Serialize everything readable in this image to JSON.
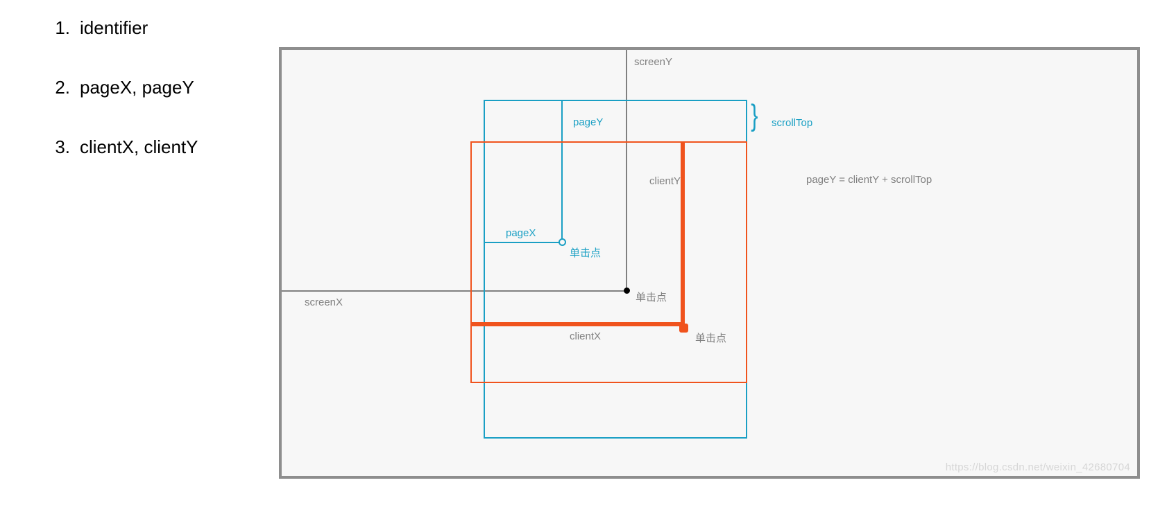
{
  "list": {
    "items": [
      {
        "num": "1.",
        "label": "identifier"
      },
      {
        "num": "2.",
        "label": "pageX, pageY"
      },
      {
        "num": "3.",
        "label": "clientX, clientY"
      }
    ]
  },
  "diagram": {
    "screenY": "screenY",
    "screenX": "screenX",
    "pageY": "pageY",
    "pageX": "pageX",
    "clientY": "clientY",
    "clientX": "clientX",
    "scrollTop": "scrollTop",
    "clickPoint": "单击点",
    "formula": "pageY = clientY + scrollTop"
  },
  "watermark": "https://blog.csdn.net/weixin_42680704",
  "colors": {
    "gray": "#808080",
    "cyan": "#1a9fc4",
    "orange": "#f0531d",
    "bg": "#f7f7f7"
  }
}
